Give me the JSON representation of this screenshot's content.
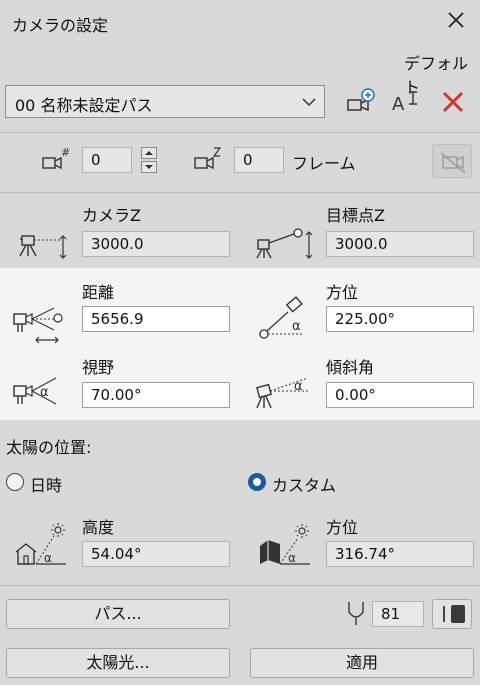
{
  "window": {
    "title": "カメラの設定"
  },
  "preset": {
    "default_label": "デフォルト",
    "selected": "00  名称未設定パス"
  },
  "frame": {
    "frame_number": "0",
    "frame_count": "0",
    "frame_label": "フレーム"
  },
  "camera": {
    "camera_z_label": "カメラZ",
    "camera_z_value": "3000.0",
    "target_z_label": "目標点Z",
    "target_z_value": "3000.0",
    "distance_label": "距離",
    "distance_value": "5656.9",
    "azimuth_label": "方位",
    "azimuth_value": "225.00°",
    "fov_label": "視野",
    "fov_value": "70.00°",
    "tilt_label": "傾斜角",
    "tilt_value": "0.00°"
  },
  "sun": {
    "section_label": "太陽の位置:",
    "option_datetime": "日時",
    "option_custom": "カスタム",
    "altitude_label": "高度",
    "altitude_value": "54.04°",
    "azimuth_label": "方位",
    "azimuth_value": "316.74°"
  },
  "footer": {
    "path_button": "パス...",
    "lens_value": "81",
    "sunlight_button": "太陽光...",
    "apply_button": "適用"
  }
}
